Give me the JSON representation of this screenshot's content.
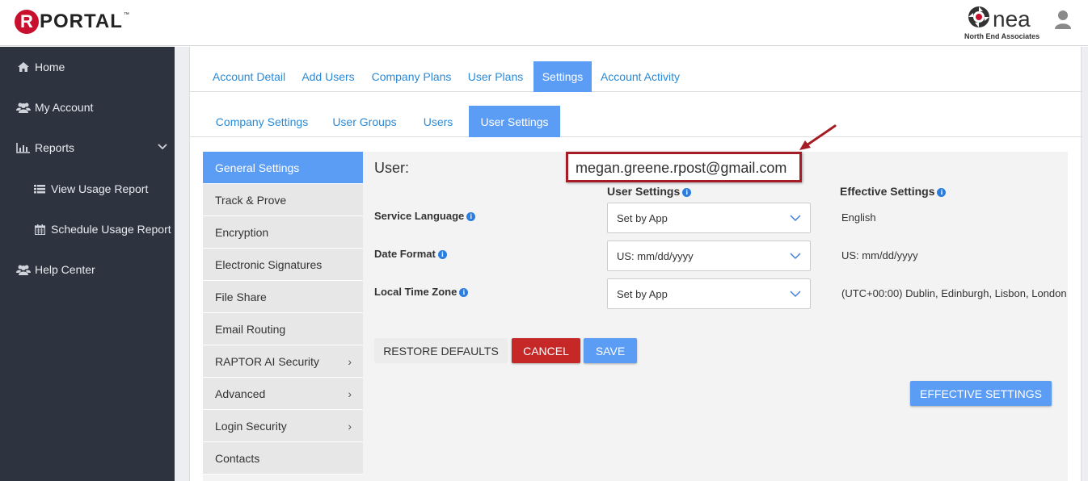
{
  "brand": {
    "logo_letter": "R",
    "logo_text": "PORTAL",
    "logo_tm": "™",
    "partner_word": "nea",
    "partner_sub": "North End Associates"
  },
  "sidebar": {
    "items": [
      {
        "label": "Home",
        "icon": "home-icon"
      },
      {
        "label": "My Account",
        "icon": "users-icon"
      },
      {
        "label": "Reports",
        "icon": "bar-chart-icon"
      },
      {
        "label": "View Usage Report",
        "icon": "list-icon"
      },
      {
        "label": "Schedule Usage Report",
        "icon": "calendar-icon"
      },
      {
        "label": "Help Center",
        "icon": "users-icon"
      }
    ]
  },
  "tabs": [
    "Account Detail",
    "Add Users",
    "Company Plans",
    "User Plans",
    "Settings",
    "Account Activity"
  ],
  "subtabs": [
    "Company Settings",
    "User Groups",
    "Users",
    "User Settings"
  ],
  "submenu": [
    "General Settings",
    "Track & Prove",
    "Encryption",
    "Electronic Signatures",
    "File Share",
    "Email Routing",
    "RAPTOR AI Security",
    "Advanced",
    "Login Security",
    "Contacts"
  ],
  "form": {
    "user_prefix": "User:",
    "user_email": "megan.greene.rpost@gmail.com",
    "col_user_settings": "User Settings",
    "col_effective": "Effective Settings",
    "rows": [
      {
        "label": "Service Language",
        "value": "Set by App",
        "effective": "English"
      },
      {
        "label": "Date Format",
        "value": "US: mm/dd/yyyy",
        "effective": "US: mm/dd/yyyy"
      },
      {
        "label": "Local Time Zone",
        "value": "Set by App",
        "effective": "(UTC+00:00) Dublin, Edinburgh, Lisbon, London"
      }
    ],
    "restore_label": "RESTORE DEFAULTS",
    "cancel_label": "CANCEL",
    "save_label": "SAVE",
    "effective_btn_label": "EFFECTIVE SETTINGS"
  },
  "colors": {
    "accent": "#5b9cf5",
    "danger": "#c62828",
    "sidebar": "#2d3440",
    "annotation": "#a51c24"
  }
}
